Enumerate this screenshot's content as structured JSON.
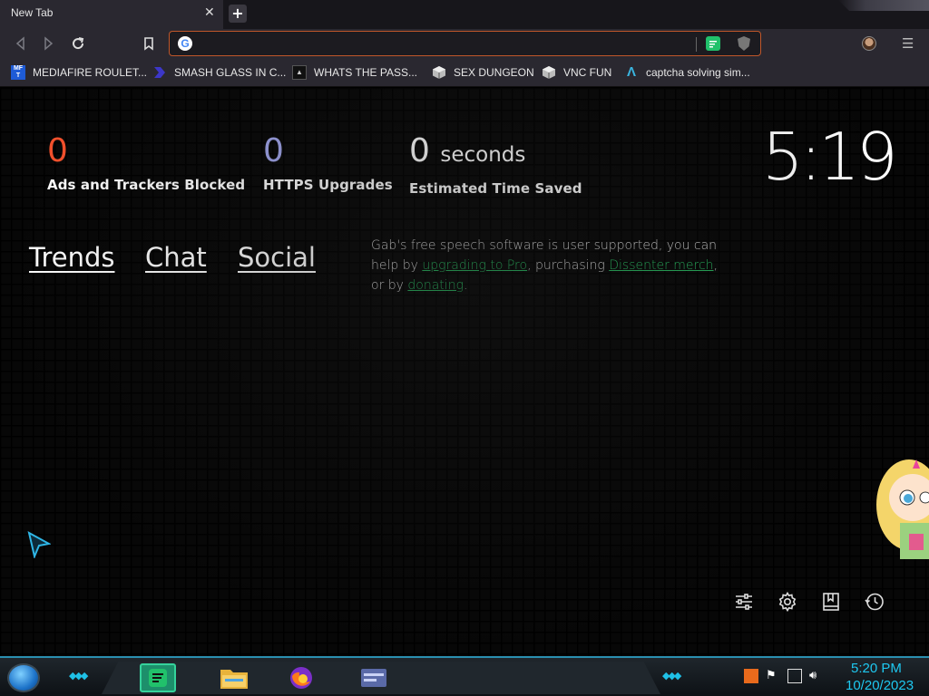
{
  "browser": {
    "tab_title": "New Tab",
    "tab_close_icon": "close-icon",
    "new_tab_icon": "plus-icon",
    "address_value": "",
    "address_placeholder": "",
    "accent": "#c0572a"
  },
  "bookmarks": [
    {
      "label": "MEDIAFIRE ROULET...",
      "icon": "mediafire-icon"
    },
    {
      "label": "SMASH GLASS IN C...",
      "icon": "bracket-icon"
    },
    {
      "label": "WHATS THE PASS...",
      "icon": "terminal-icon"
    },
    {
      "label": "SEX DUNGEON",
      "icon": "cube-icon"
    },
    {
      "label": "VNC FUN",
      "icon": "cube-icon"
    },
    {
      "label": "captcha solving sim...",
      "icon": "lambda-icon"
    }
  ],
  "stats": {
    "ads_value": "0",
    "ads_label": "Ads and Trackers Blocked",
    "https_value": "0",
    "https_label": "HTTPS Upgrades",
    "time_value": "0",
    "time_unit": "seconds",
    "time_label": "Estimated Time Saved",
    "ads_color": "#f4512c",
    "https_color": "#a0a5eb"
  },
  "clock": "5:19",
  "nav": {
    "trends": "Trends",
    "chat": "Chat",
    "social": "Social"
  },
  "support": {
    "text1": "Gab's free speech software is user supported, you can help by ",
    "link1": "upgrading to Pro",
    "text2": ", purchasing ",
    "link2": "Dissenter merch",
    "text3": ", or by ",
    "link3": "donating",
    "text4": ".",
    "link_color": "#27b35d"
  },
  "bottom_icons": [
    "sliders-icon",
    "gear-icon",
    "bookmark-icon",
    "history-icon"
  ],
  "taskbar": {
    "time": "5:20 PM",
    "date": "10/20/2023",
    "apps": [
      "notes-app-icon",
      "file-explorer-icon",
      "firefox-icon",
      "window-icon"
    ],
    "accent": "#1ec8f0"
  }
}
